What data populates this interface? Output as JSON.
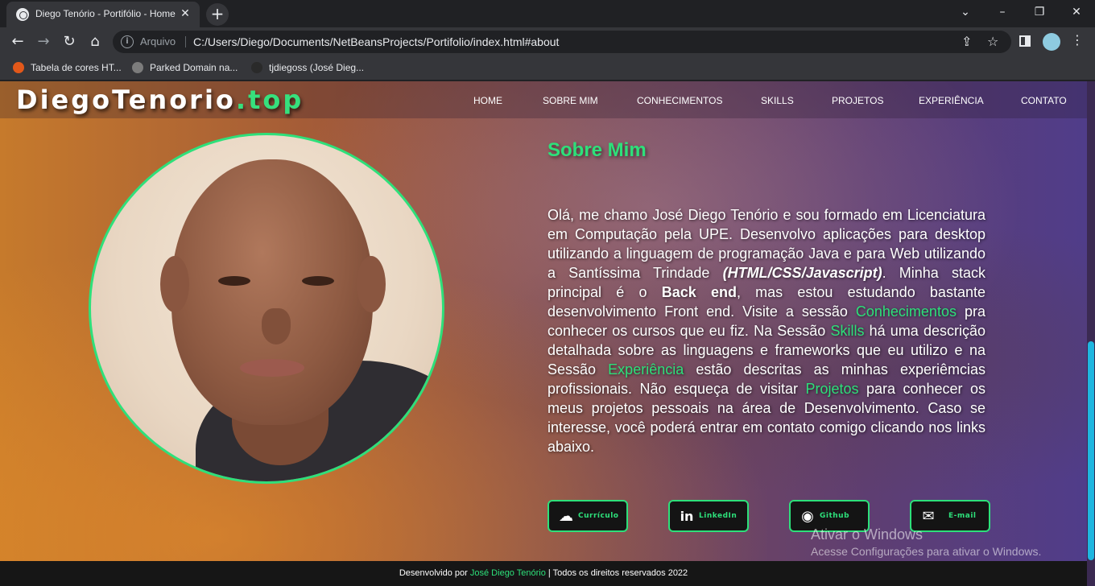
{
  "browser": {
    "tab_title": "Diego Tenório - Portifólio - Home",
    "close_glyph": "✕",
    "new_tab_glyph": "+",
    "scheme_label": "Arquivo",
    "url": "C:/Users/Diego/Documents/NetBeansProjects/Portifolio/index.html#about",
    "bookmarks": [
      {
        "label": "Tabela de cores HT...",
        "icon_color": "#e2581a"
      },
      {
        "label": "Parked Domain na...",
        "icon_color": "#7c7c7c"
      },
      {
        "label": "tjdiegoss (José Dieg...",
        "icon_color": "#2a2a2a"
      }
    ]
  },
  "site": {
    "logo_main": "DiegoTenorio",
    "logo_tld": ".top",
    "nav": [
      "HOME",
      "SOBRE MIM",
      "CONHECIMENTOS",
      "SKILLS",
      "PROJETOS",
      "EXPERIÊNCIA",
      "CONTATO"
    ],
    "section_title": "Sobre Mim",
    "bio": {
      "p1": "Olá, me chamo José Diego Tenório e sou formado em Licenciatura em Computação pela UPE. Desenvolvo aplicações para desktop utilizando a linguagem de programação Java e para Web utilizando a Santíssima Trindade ",
      "stack_italic": "(HTML/CSS/Javascript)",
      "p2": ". Minha stack principal é o ",
      "back_end": "Back end",
      "p3": ", mas estou estudando bastante desenvolvimento Front end. Visite a sessão ",
      "link_conhecimentos": "Conhecimentos",
      "p4": " pra conhecer os cursos que eu fiz. Na Sessão ",
      "link_skills": "Skills",
      "p5": " há uma descrição detalhada sobre as linguagens e frameworks que eu utilizo e na Sessão ",
      "link_experiencia": "Experiência",
      "p6": " estão descritas as minhas experiêmcias profissionais. Não esqueça de visitar ",
      "link_projetos": "Projetos",
      "p7": " para conhecer os meus projetos pessoais na área de Desenvolvimento. Caso se interesse, você poderá entrar em contato comigo clicando nos links abaixo."
    },
    "buttons": [
      {
        "label": "Currículo",
        "icon": "cloud-download-icon",
        "glyph": "☁"
      },
      {
        "label": "LinkedIn",
        "icon": "linkedin-icon",
        "glyph": "in"
      },
      {
        "label": "Github",
        "icon": "github-icon",
        "glyph": "◉"
      },
      {
        "label": "E-mail",
        "icon": "mail-icon",
        "glyph": "✉"
      }
    ],
    "footer": {
      "prefix": "Desenvolvido por ",
      "author": "José Diego Tenório",
      "suffix": " | Todos os direitos reservados 2022"
    }
  },
  "os_watermark": {
    "line1": "Ativar o Windows",
    "line2": "Acesse Configurações para ativar o Windows."
  },
  "colors": {
    "accent": "#2de07a",
    "footer_bg": "#161616",
    "chrome_bg": "#35363a"
  }
}
